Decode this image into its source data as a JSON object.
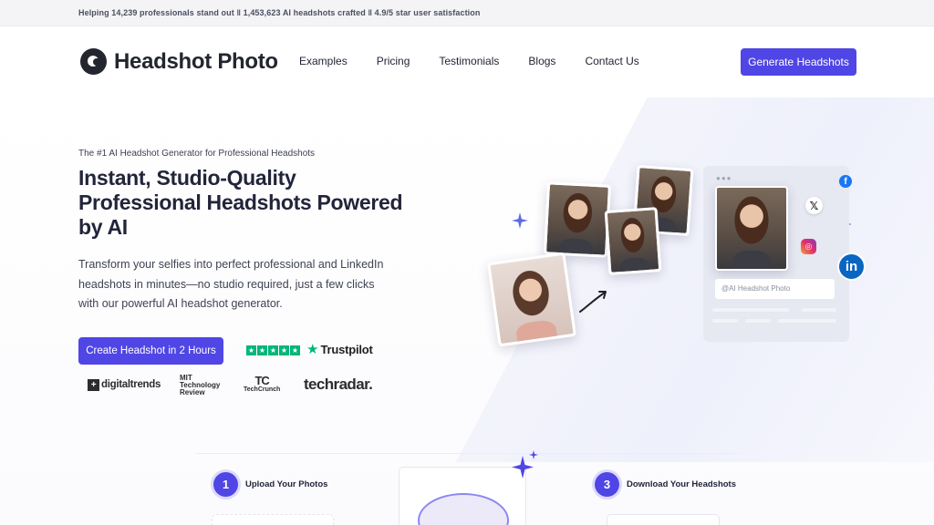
{
  "topbar": {
    "text": "Helping 14,239 professionals stand out ‖ 1,453,623 AI headshots crafted ‖ 4.9/5 star user satisfaction"
  },
  "header": {
    "logo_text": "Headshot Photo",
    "nav": [
      "Examples",
      "Pricing",
      "Testimonials",
      "Blogs",
      "Contact Us"
    ],
    "cta": "Generate Headshots"
  },
  "hero": {
    "eyebrow": "The #1 AI Headshot Generator for Professional Headshots",
    "title": "Instant, Studio-Quality Professional Headshots Powered by AI",
    "subtitle": "Transform your selfies into perfect professional and LinkedIn headshots in minutes—no studio required, just a few clicks with our powerful AI headshot generator.",
    "cta": "Create Headshot in 2 Hours",
    "trustpilot": "Trustpilot",
    "press": {
      "digitaltrends": "digitaltrends",
      "mit": [
        "MIT",
        "Technology",
        "Review"
      ],
      "techcrunch_mark": "TC",
      "techcrunch": "TechCrunch",
      "techradar": "techradar."
    }
  },
  "visual": {
    "panel_input": "@AI Headshot Photo",
    "icons": [
      "facebook-icon",
      "x-icon",
      "instagram-icon",
      "linkedin-icon"
    ]
  },
  "steps": [
    {
      "num": "1",
      "label": "Upload Your Photos"
    },
    {
      "num": "3",
      "label": "Download Your Headshots"
    }
  ],
  "colors": {
    "accent": "#4f46e5",
    "trustpilot": "#00b67a",
    "linkedin": "#0a66c2",
    "facebook": "#1877f2"
  }
}
